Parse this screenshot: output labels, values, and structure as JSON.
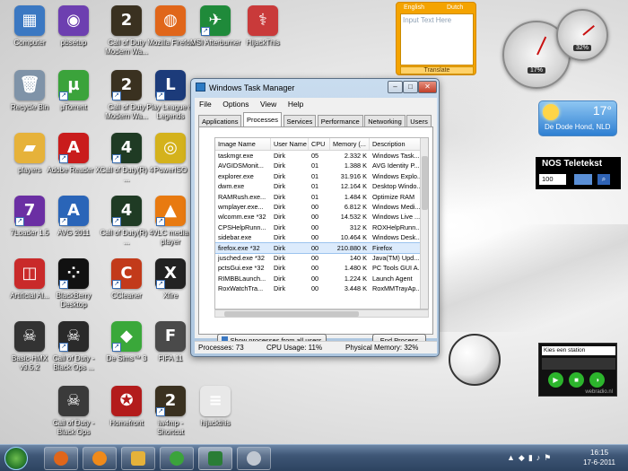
{
  "desktop_icons": [
    {
      "label": "Computer",
      "glyph": "▦",
      "color": "#3b78c2",
      "shortcut": false
    },
    {
      "label": "Recycle Bin",
      "glyph": "🗑",
      "color": "#7f93a8",
      "shortcut": false
    },
    {
      "label": "players",
      "glyph": "▰",
      "color": "#e6b23a",
      "shortcut": false
    },
    {
      "label": "7Loader 1.5",
      "glyph": "7",
      "color": "#6b2fa3",
      "shortcut": true
    },
    {
      "label": "Artificial Al...",
      "glyph": "◫",
      "color": "#c92a2a",
      "shortcut": false
    },
    {
      "label": "Basic-HMX v3.5.2",
      "glyph": "☠",
      "color": "#333333",
      "shortcut": false
    },
    {
      "label": "pbsetup",
      "glyph": "◉",
      "color": "#6d3fb0",
      "shortcut": false
    },
    {
      "label": "µTorrent",
      "glyph": "µ",
      "color": "#3ba33b",
      "shortcut": true
    },
    {
      "label": "Adobe Reader X",
      "glyph": "A",
      "color": "#c91c1c",
      "shortcut": true
    },
    {
      "label": "AVG 2011",
      "glyph": "A",
      "color": "#2a65b8",
      "shortcut": true
    },
    {
      "label": "BlackBerry Desktop",
      "glyph": "⁘",
      "color": "#111111",
      "shortcut": true
    },
    {
      "label": "Call of Duty - Black Ops ...",
      "glyph": "☠",
      "color": "#2a2a2a",
      "shortcut": true
    },
    {
      "label": "Call of Duty - Black Ops",
      "glyph": "☠",
      "color": "#3a3a3a",
      "shortcut": false
    },
    {
      "label": "Call of Duty Modern Wa...",
      "glyph": "2",
      "color": "#3a3120",
      "shortcut": false
    },
    {
      "label": "Call of Duty Modern Wa...",
      "glyph": "2",
      "color": "#3a3120",
      "shortcut": true
    },
    {
      "label": "Call of Duty(R) 4 ...",
      "glyph": "4",
      "color": "#1f3b24",
      "shortcut": true
    },
    {
      "label": "Call of Duty(R) 4 ...",
      "glyph": "4",
      "color": "#1f3b24",
      "shortcut": true
    },
    {
      "label": "CCleaner",
      "glyph": "C",
      "color": "#c23a1a",
      "shortcut": true
    },
    {
      "label": "De Sims™ 3",
      "glyph": "◆",
      "color": "#3aa83a",
      "shortcut": true
    },
    {
      "label": "Homefront",
      "glyph": "✪",
      "color": "#b31c1c",
      "shortcut": false
    },
    {
      "label": "Mozilla Firefox",
      "glyph": "◍",
      "color": "#e0661a",
      "shortcut": false
    },
    {
      "label": "Play League of Legends",
      "glyph": "L",
      "color": "#1c3b7a",
      "shortcut": true
    },
    {
      "label": "PowerISO",
      "glyph": "◎",
      "color": "#d4b21c",
      "shortcut": false
    },
    {
      "label": "VLC media player",
      "glyph": "▲",
      "color": "#e87a10",
      "shortcut": true
    },
    {
      "label": "Xfire",
      "glyph": "X",
      "color": "#222222",
      "shortcut": true
    },
    {
      "label": "FIFA 11",
      "glyph": "F",
      "color": "#4a4a4a",
      "shortcut": false
    },
    {
      "label": "iw4mp - Shortcut",
      "glyph": "2",
      "color": "#3a3120",
      "shortcut": true
    },
    {
      "label": "MSI Afterburner",
      "glyph": "✈",
      "color": "#1f8a3a",
      "shortcut": true
    },
    {
      "label": "HijackThis",
      "glyph": "⚕",
      "color": "#c93a3a",
      "shortcut": false
    },
    {
      "label": "hijackthis",
      "glyph": "≡",
      "color": "#e8e8e8",
      "shortcut": false
    }
  ],
  "task_manager": {
    "title": "Windows Task Manager",
    "menu": [
      "File",
      "Options",
      "View",
      "Help"
    ],
    "tabs": [
      "Applications",
      "Processes",
      "Services",
      "Performance",
      "Networking",
      "Users"
    ],
    "active_tab": "Processes",
    "columns": [
      "Image Name",
      "User Name",
      "CPU",
      "Memory (...",
      "Description"
    ],
    "rows": [
      [
        "taskmgr.exe",
        "Dirk",
        "05",
        "2.332 K",
        "Windows Task..."
      ],
      [
        "AVGIDSMonit...",
        "Dirk",
        "01",
        "1.388 K",
        "AVG Identity P..."
      ],
      [
        "explorer.exe",
        "Dirk",
        "01",
        "31.916 K",
        "Windows Explo..."
      ],
      [
        "dwm.exe",
        "Dirk",
        "01",
        "12.164 K",
        "Desktop Windo..."
      ],
      [
        "RAMRush.exe...",
        "Dirk",
        "01",
        "1.484 K",
        "Optimize RAM"
      ],
      [
        "wmplayer.exe...",
        "Dirk",
        "00",
        "6.812 K",
        "Windows Medi..."
      ],
      [
        "wlcomm.exe *32",
        "Dirk",
        "00",
        "14.532 K",
        "Windows Live ..."
      ],
      [
        "CPSHelpRunn...",
        "Dirk",
        "00",
        "312 K",
        "ROXHelpRunn..."
      ],
      [
        "sidebar.exe",
        "Dirk",
        "00",
        "10.464 K",
        "Windows Desk..."
      ],
      [
        "firefox.exe *32",
        "Dirk",
        "00",
        "210.880 K",
        "Firefox"
      ],
      [
        "jusched.exe *32",
        "Dirk",
        "00",
        "140 K",
        "Java(TM) Upd..."
      ],
      [
        "pctsGui.exe *32",
        "Dirk",
        "00",
        "1.480 K",
        "PC Tools GUI A..."
      ],
      [
        "RIMBBLaunch...",
        "Dirk",
        "00",
        "1.224 K",
        "Launch Agent"
      ],
      [
        "RoxWatchTra...",
        "Dirk",
        "00",
        "3.448 K",
        "RoxMMTrayAp..."
      ]
    ],
    "selected_row": 9,
    "show_all_label": "Show processes from all users",
    "end_process_label": "End Process",
    "status": {
      "processes": "Processes: 73",
      "cpu": "CPU Usage: 11%",
      "memory": "Physical Memory: 32%"
    }
  },
  "translator": {
    "lang_from": "English",
    "lang_to": "Dutch",
    "placeholder": "Input Text Here",
    "button": "Translate"
  },
  "meters": {
    "cpu_percent": "17%",
    "ram_percent": "32%"
  },
  "weather": {
    "temperature": "17°",
    "city": "De Dode Hond, NLD"
  },
  "teletekst": {
    "title": "NOS Teletekst",
    "page": "100"
  },
  "radio": {
    "station_placeholder": "Kies een station",
    "brand": "webradio.nl"
  },
  "clock": {
    "time": "16:15",
    "date": "17-6-2011"
  }
}
